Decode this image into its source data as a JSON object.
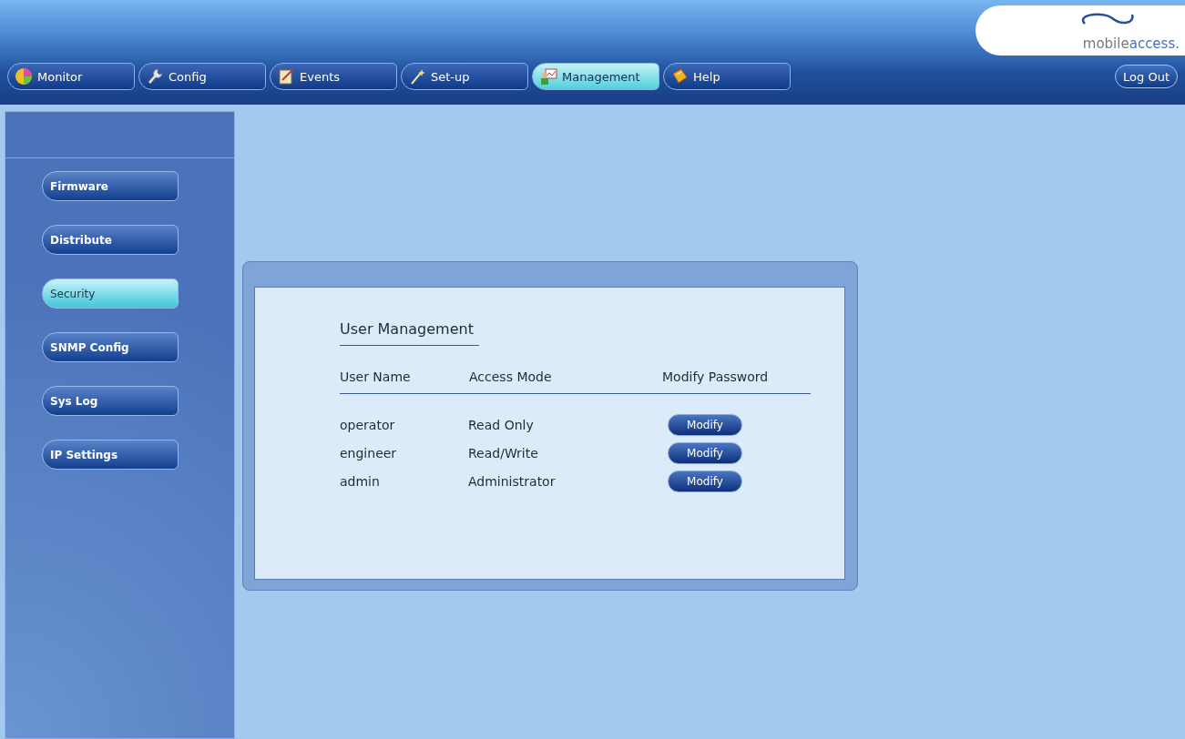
{
  "logo": {
    "part_1": "mobile",
    "part_2": "access."
  },
  "tabs": [
    {
      "label": "Monitor",
      "selected": false
    },
    {
      "label": "Config",
      "selected": false
    },
    {
      "label": "Events",
      "selected": false
    },
    {
      "label": "Set-up",
      "selected": false
    },
    {
      "label": "Management",
      "selected": true
    },
    {
      "label": "Help",
      "selected": false
    }
  ],
  "logout": "Log Out",
  "sidebar": {
    "items": [
      {
        "label": "Firmware",
        "selected": false
      },
      {
        "label": "Distribute",
        "selected": false
      },
      {
        "label": "Security",
        "selected": true
      },
      {
        "label": "SNMP Config",
        "selected": false
      },
      {
        "label": "Sys Log",
        "selected": false
      },
      {
        "label": "IP Settings",
        "selected": false
      }
    ]
  },
  "panel": {
    "title": "User Management",
    "columns": [
      "User Name",
      "Access Mode",
      "Modify Password"
    ],
    "rows": [
      {
        "user": "operator",
        "mode": "Read Only",
        "button": "Modify"
      },
      {
        "user": "engineer",
        "mode": "Read/Write",
        "button": "Modify"
      },
      {
        "user": "admin",
        "mode": "Administrator",
        "button": "Modify"
      }
    ]
  }
}
